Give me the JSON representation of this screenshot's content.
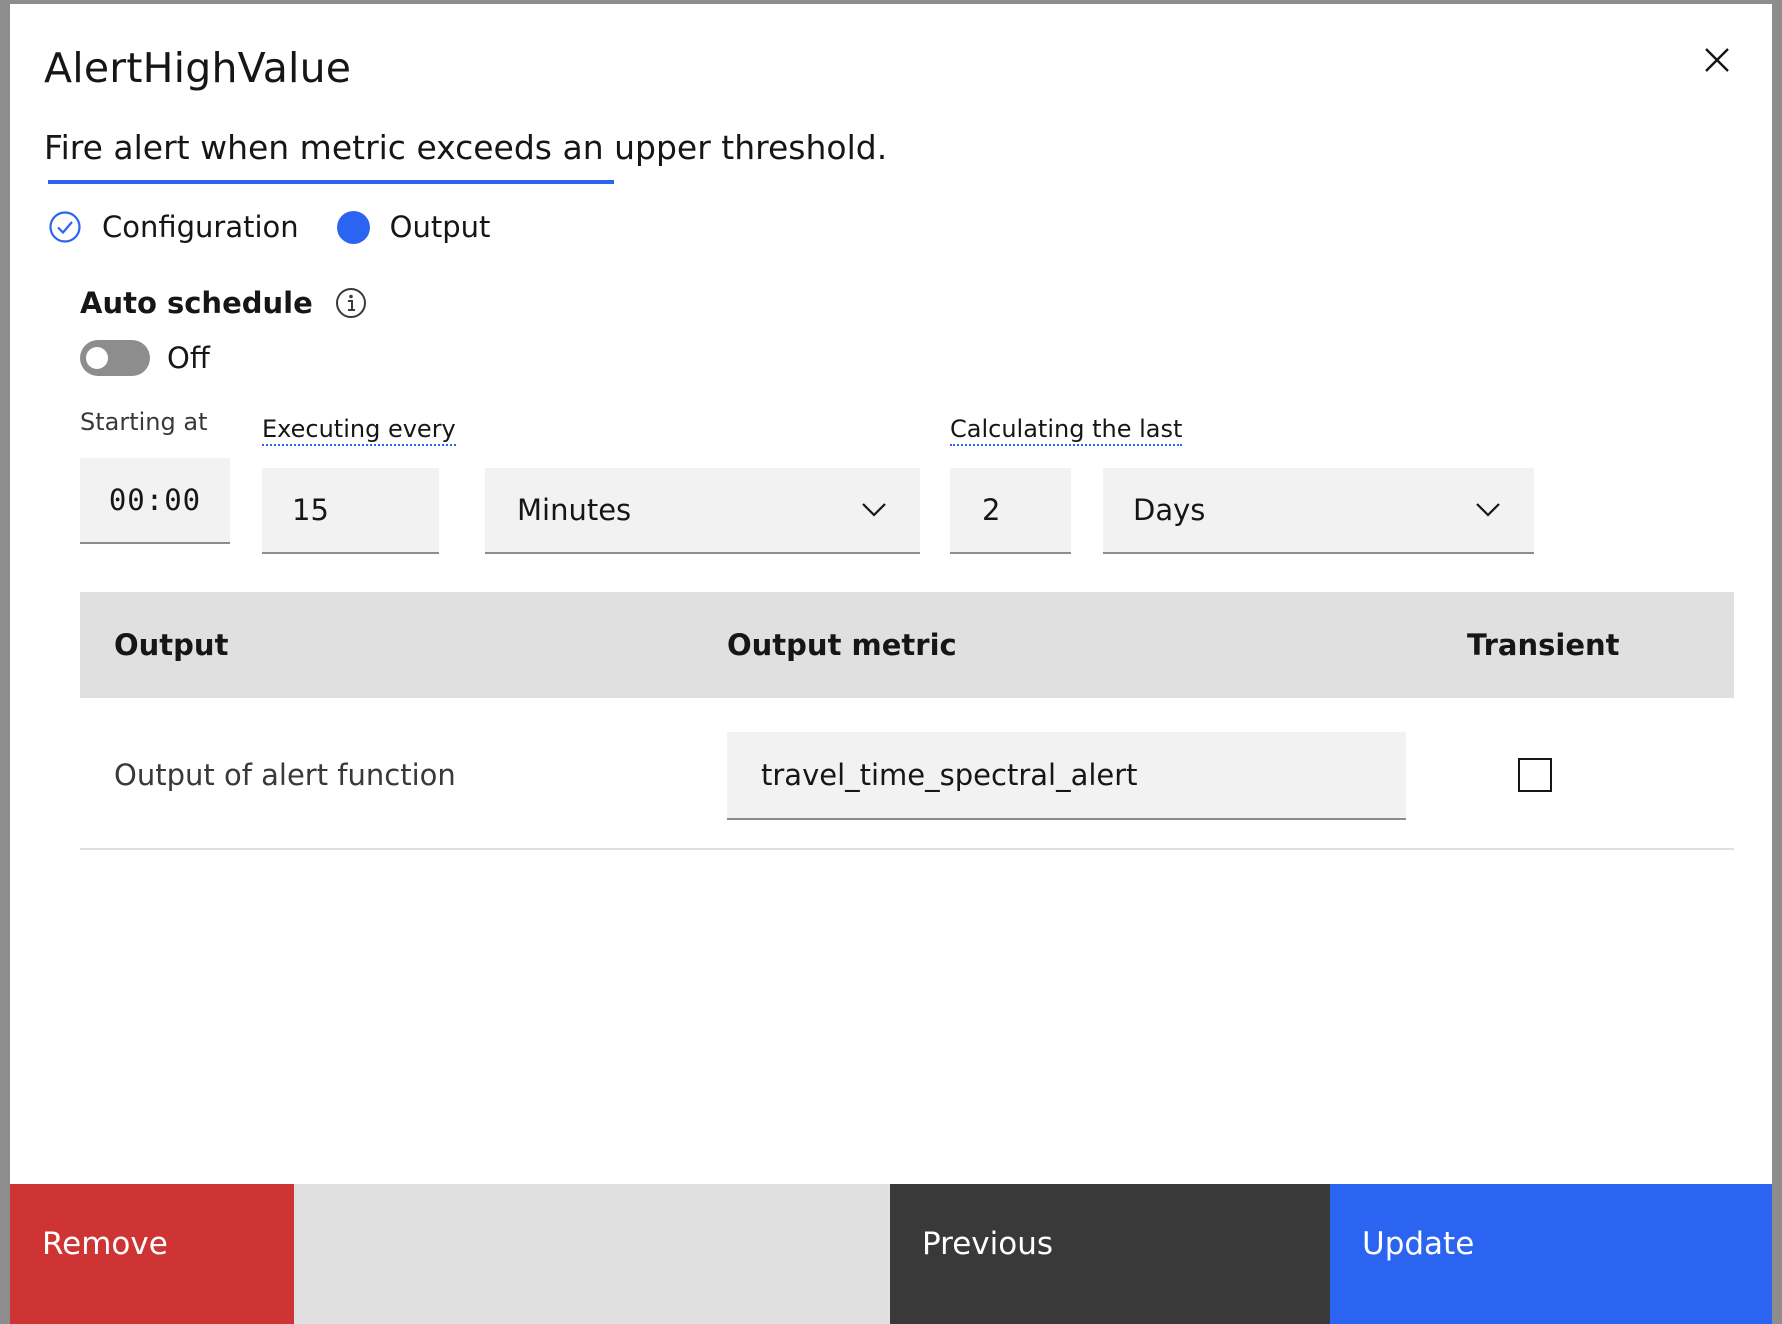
{
  "modal": {
    "title": "AlertHighValue",
    "subtitle": "Fire alert when metric exceeds an upper threshold."
  },
  "steps": [
    {
      "label": "Configuration",
      "state": "complete",
      "icon": "check-circle-icon"
    },
    {
      "label": "Output",
      "state": "current",
      "icon": "filled-dot-icon"
    }
  ],
  "schedule": {
    "label": "Auto schedule",
    "toggle_state": "Off"
  },
  "fields": {
    "starting_at_label": "Starting at",
    "starting_at_value": "00:00",
    "executing_every_label": "Executing every",
    "executing_every_value": "15",
    "executing_unit": "Minutes",
    "calculating_label": "Calculating the last",
    "calculating_value": "2",
    "calculating_unit": "Days"
  },
  "table": {
    "headers": [
      "Output",
      "Output metric",
      "Transient"
    ],
    "rows": [
      {
        "output": "Output of alert function",
        "metric": "travel_time_spectral_alert",
        "transient": false
      }
    ]
  },
  "footer": {
    "remove": "Remove",
    "previous": "Previous",
    "update": "Update"
  },
  "colors": {
    "accent": "#2a64f0",
    "danger": "#cd3433",
    "secondary": "#393939"
  }
}
